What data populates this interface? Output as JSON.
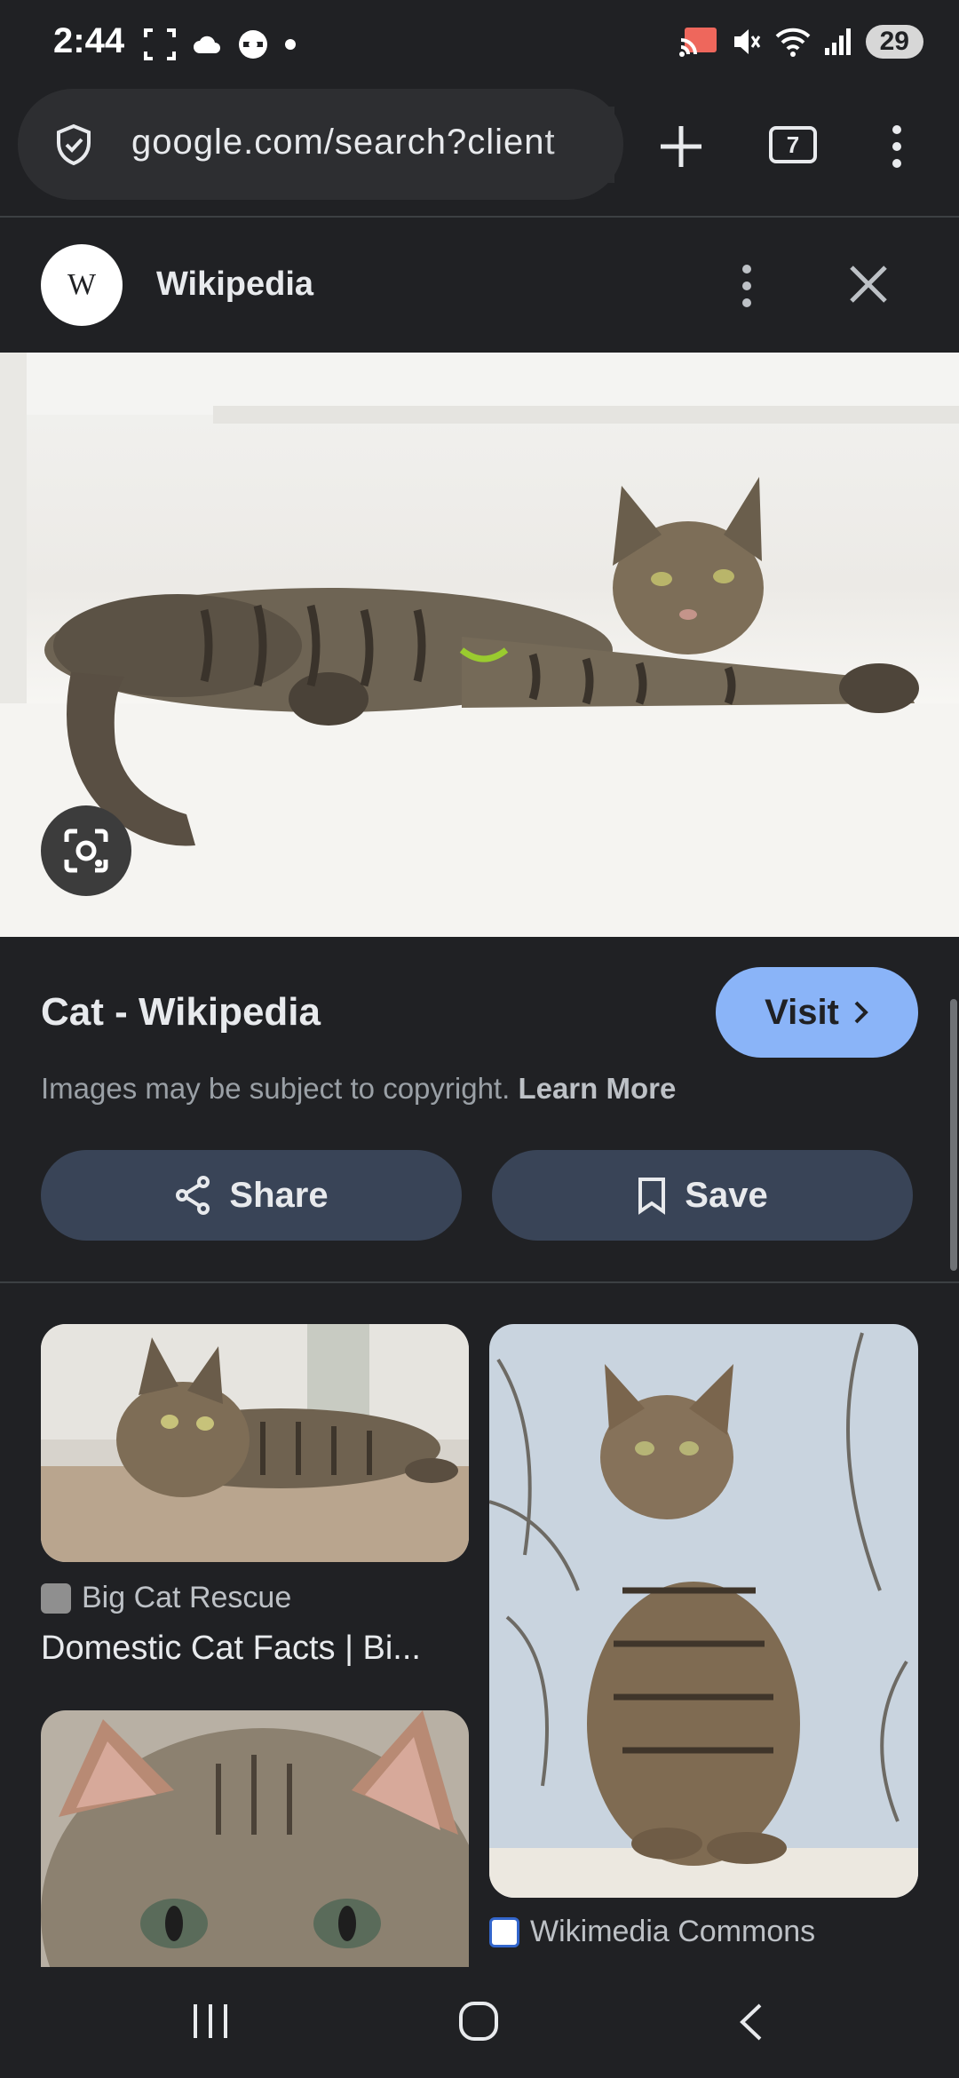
{
  "status_bar": {
    "time": "2:44",
    "battery": "29",
    "icons": [
      "screenshot-icon",
      "cloud-icon",
      "vpn-icon",
      "dot-icon",
      "cast-icon",
      "mute-icon",
      "wifi-icon",
      "signal-icon"
    ]
  },
  "toolbar": {
    "url": "google.com/search?client",
    "tab_count": "7",
    "icons": [
      "shield-icon",
      "new-tab-icon",
      "tab-switcher-icon",
      "more-vert-icon"
    ]
  },
  "source_header": {
    "logo_text": "W",
    "name": "Wikipedia"
  },
  "result": {
    "title": "Cat - Wikipedia",
    "visit_label": "Visit",
    "copyright_text": "Images may be subject to copyright.",
    "learn_more": "Learn More",
    "share_label": "Share",
    "save_label": "Save"
  },
  "related": [
    {
      "source": "Big Cat Rescue",
      "title": "Domestic Cat Facts | Bi..."
    },
    {
      "source": "Wikimedia Commons",
      "title": ""
    }
  ],
  "colors": {
    "background": "#202124",
    "accent": "#8ab4f8",
    "action_button": "#394457"
  }
}
